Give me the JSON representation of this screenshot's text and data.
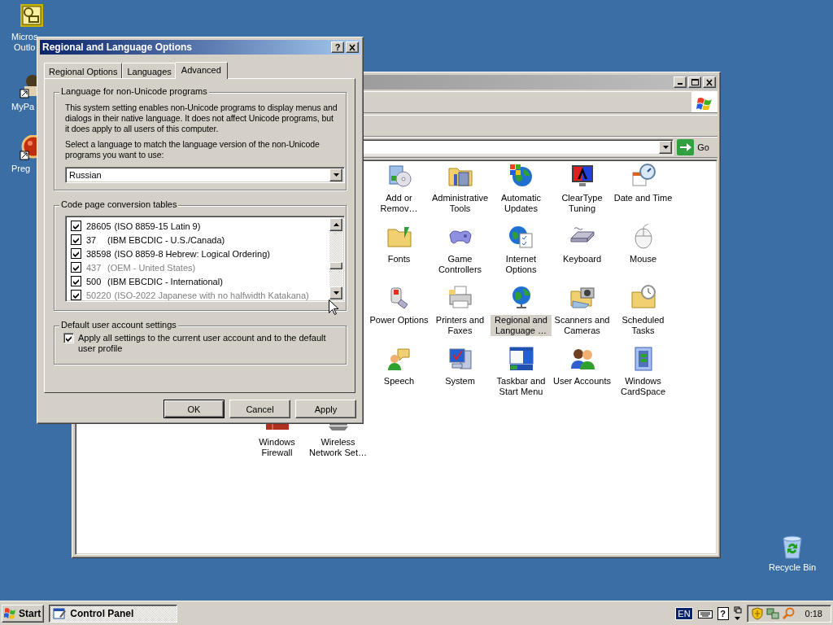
{
  "desktop_icons": [
    {
      "lines": [
        "Micros",
        "Outlo"
      ]
    },
    {
      "lines": [
        "MyPa"
      ]
    },
    {
      "lines": [
        "Preg"
      ]
    },
    {
      "lines": [
        "Recycle Bin"
      ]
    }
  ],
  "control_panel": {
    "address_bar": {
      "go_button": "Go"
    },
    "icons": [
      {
        "label": "Add or Remov…",
        "selected": false
      },
      {
        "label": "Administrative Tools",
        "selected": false
      },
      {
        "label": "Automatic Updates",
        "selected": false
      },
      {
        "label": "ClearType Tuning",
        "selected": false
      },
      {
        "label": "Date and Time",
        "selected": false
      },
      {
        "label": "Fonts",
        "selected": false
      },
      {
        "label": "Game Controllers",
        "selected": false
      },
      {
        "label": "Internet Options",
        "selected": false
      },
      {
        "label": "Keyboard",
        "selected": false
      },
      {
        "label": "Mouse",
        "selected": false
      },
      {
        "label": "Power Options",
        "selected": false
      },
      {
        "label": "Printers and Faxes",
        "selected": false
      },
      {
        "label": "Regional and Language …",
        "selected": true
      },
      {
        "label": "Scanners and Cameras",
        "selected": false
      },
      {
        "label": "Scheduled Tasks",
        "selected": false
      },
      {
        "label": "Speech",
        "selected": false
      },
      {
        "label": "System",
        "selected": false
      },
      {
        "label": "Taskbar and Start Menu",
        "selected": false
      },
      {
        "label": "User Accounts",
        "selected": false
      },
      {
        "label": "Windows CardSpace",
        "selected": false
      },
      {
        "label": "Windows Firewall",
        "selected": false
      },
      {
        "label": "Wireless Network Set…",
        "selected": false
      }
    ]
  },
  "dialog": {
    "title": "Regional and Language Options",
    "help_button": "?",
    "tabs": [
      {
        "label": "Regional Options",
        "selected": false
      },
      {
        "label": "Languages",
        "selected": false
      },
      {
        "label": "Advanced",
        "selected": true
      }
    ],
    "non_unicode": {
      "title": "Language for non-Unicode programs",
      "description": "This system setting enables non-Unicode programs to display menus and dialogs in their native language. It does not affect Unicode programs, but it does apply to all users of this computer.",
      "prompt": "Select a language to match the language version of the non-Unicode programs you want to use:",
      "language": "Russian"
    },
    "code_pages": {
      "title": "Code page conversion tables",
      "items": [
        {
          "code": "28605",
          "name": "(ISO 8859-15 Latin 9)",
          "checked": true,
          "dimmed": false
        },
        {
          "code": "37",
          "name": "(IBM EBCDIC - U.S./Canada)",
          "checked": true,
          "dimmed": false
        },
        {
          "code": "38598",
          "name": "(ISO 8859-8 Hebrew: Logical Ordering)",
          "checked": true,
          "dimmed": false
        },
        {
          "code": "437",
          "name": "(OEM - United States)",
          "checked": true,
          "dimmed": true
        },
        {
          "code": "500",
          "name": "(IBM EBCDIC - International)",
          "checked": true,
          "dimmed": false
        },
        {
          "code": "50220",
          "name": "(ISO-2022 Japanese with no halfwidth Katakana)",
          "checked": true,
          "dimmed": true
        }
      ]
    },
    "default_user": {
      "title": "Default user account settings",
      "label": "Apply all settings to the current user account and to the default user profile",
      "checked": true
    },
    "buttons": [
      {
        "label": "OK",
        "default": true
      },
      {
        "label": "Cancel",
        "default": false
      },
      {
        "label": "Apply",
        "default": false
      }
    ]
  },
  "taskbar": {
    "start": "Start",
    "tasks": [
      {
        "label": "Control Panel",
        "selected": true
      }
    ],
    "language": "EN",
    "help": "?",
    "clock": "0:18"
  }
}
